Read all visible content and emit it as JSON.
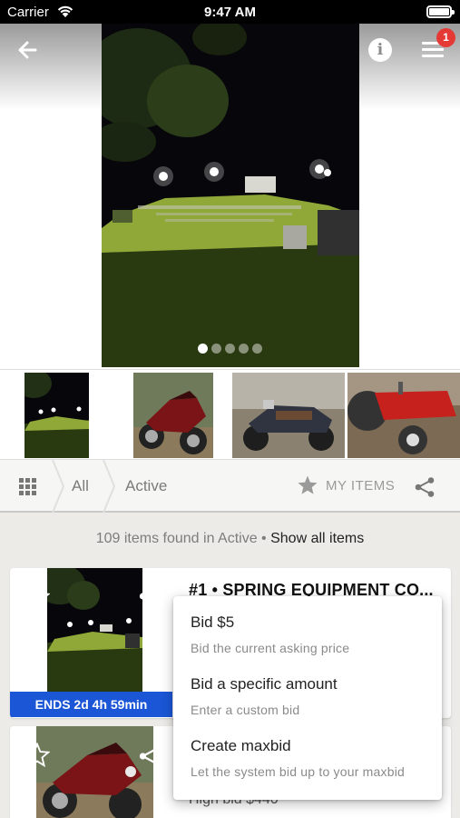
{
  "status_bar": {
    "carrier": "Carrier",
    "time": "9:47 AM"
  },
  "header": {
    "notification_count": "1"
  },
  "gallery": {
    "slides": 5,
    "active_slide": 1
  },
  "filters": {
    "all_label": "All",
    "active_label": "Active",
    "my_items_label": "MY ITEMS"
  },
  "results": {
    "count_text": "109 items found in",
    "filter_name": "Active",
    "separator": " • ",
    "show_all": "Show all items"
  },
  "items": [
    {
      "title": "#1 • SPRING EQUIPMENT CO...",
      "ends": "ENDS 2d 4h 59min"
    },
    {
      "high_bid": "High bid $440"
    }
  ],
  "bid_menu": {
    "options": [
      {
        "title": "Bid $5",
        "subtitle": "Bid the current asking price"
      },
      {
        "title": "Bid a specific amount",
        "subtitle": "Enter a custom bid"
      },
      {
        "title": "Create maxbid",
        "subtitle": "Let the system bid up to your maxbid"
      }
    ]
  },
  "colors": {
    "accent_blue": "#1a56d6",
    "badge_red": "#e53935",
    "grass_green": "#8fa838"
  }
}
